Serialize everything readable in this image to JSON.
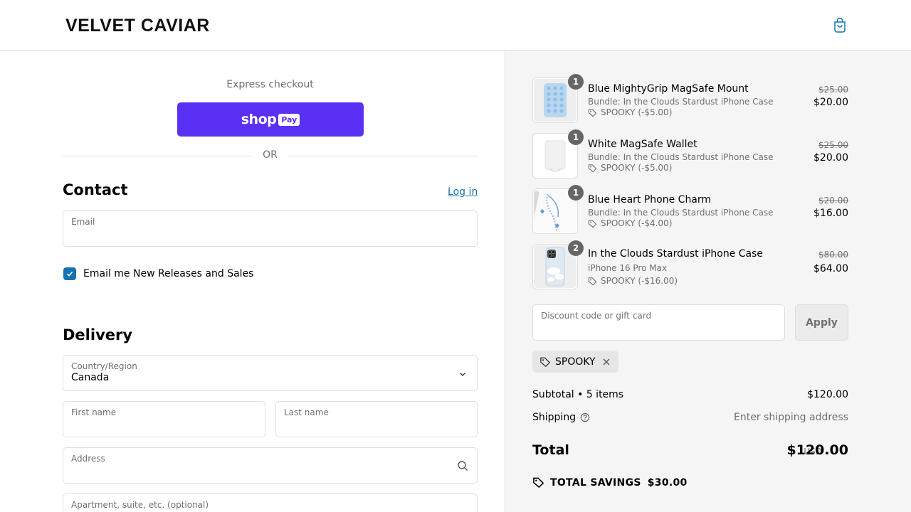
{
  "header": {
    "logo_text": "VELVET CAVIAR",
    "cart_icon": "shopping-bag-icon"
  },
  "express": {
    "label": "Express checkout",
    "shop_pay_word": "shop",
    "shop_pay_box": "Pay",
    "brand_color": "#5a31f4",
    "or_text": "OR"
  },
  "contact": {
    "title": "Contact",
    "login_link": "Log in",
    "email_label": "Email",
    "email_value": "",
    "newsletter_label": "Email me New Releases and Sales",
    "newsletter_checked": true
  },
  "delivery": {
    "title": "Delivery",
    "country_label": "Country/Region",
    "country_value": "Canada",
    "first_name_label": "First name",
    "last_name_label": "Last name",
    "address_label": "Address",
    "apartment_label": "Apartment, suite, etc. (optional)"
  },
  "order": {
    "items": [
      {
        "name": "Blue MightyGrip MagSafe Mount",
        "variant": "Bundle: In the Clouds Stardust iPhone Case",
        "discount": "SPOOKY (-$5.00)",
        "old_price": "$25.00",
        "price": "$20.00",
        "qty": "1"
      },
      {
        "name": "White MagSafe Wallet",
        "variant": "Bundle: In the Clouds Stardust iPhone Case",
        "discount": "SPOOKY (-$5.00)",
        "old_price": "$25.00",
        "price": "$20.00",
        "qty": "1"
      },
      {
        "name": "Blue Heart Phone Charm",
        "variant": "Bundle: In the Clouds Stardust iPhone Case",
        "discount": "SPOOKY (-$4.00)",
        "old_price": "$20.00",
        "price": "$16.00",
        "qty": "1"
      },
      {
        "name": "In the Clouds Stardust iPhone Case",
        "variant": "iPhone 16 Pro Max",
        "discount": "SPOOKY (-$16.00)",
        "old_price": "$80.00",
        "price": "$64.00",
        "qty": "2"
      }
    ],
    "discount_placeholder": "Discount code or gift card",
    "apply_label": "Apply",
    "applied_code": "SPOOKY",
    "subtotal_label": "Subtotal • 5 items",
    "subtotal_value": "$120.00",
    "shipping_label": "Shipping",
    "shipping_value": "Enter shipping address",
    "total_label": "Total",
    "total_currency": "USD",
    "total_value": "$120.00",
    "savings_label": "TOTAL SAVINGS",
    "savings_value": "$30.00"
  },
  "colors": {
    "link": "#1773b0",
    "checkbox": "#1773b0",
    "summary_bg": "#f5f5f5"
  }
}
